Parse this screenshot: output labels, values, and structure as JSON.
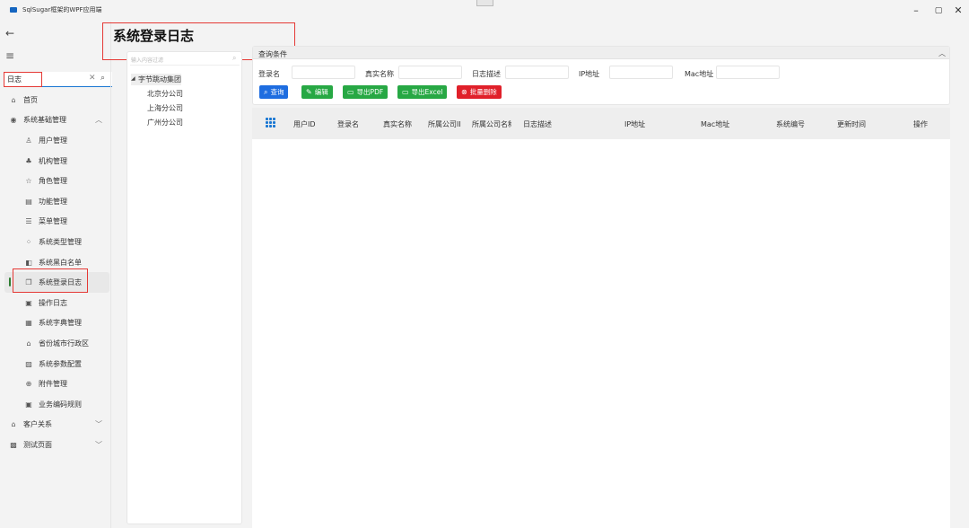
{
  "window": {
    "title": "SqlSugar框架的WPF应用端",
    "minimize": "–",
    "maximize": "▢",
    "close": "✕"
  },
  "nav": {
    "back": "←",
    "menu": "≡",
    "search_value": "日志",
    "search_clear": "✕",
    "search_icon": "⌕",
    "items": [
      {
        "label": "首页",
        "icon": "⌂"
      },
      {
        "label": "系统基础管理",
        "icon": "◉",
        "chevron": "︿"
      },
      {
        "label": "用户管理",
        "icon": "♙"
      },
      {
        "label": "机构管理",
        "icon": "♣"
      },
      {
        "label": "角色管理",
        "icon": "☆"
      },
      {
        "label": "功能管理",
        "icon": "▤"
      },
      {
        "label": "菜单管理",
        "icon": "☰"
      },
      {
        "label": "系统类型管理",
        "icon": "⁘"
      },
      {
        "label": "系统黑白名单",
        "icon": "◧"
      },
      {
        "label": "系统登录日志",
        "icon": "❐"
      },
      {
        "label": "操作日志",
        "icon": "▣"
      },
      {
        "label": "系统字典管理",
        "icon": "▦"
      },
      {
        "label": "省份城市行政区",
        "icon": "⌂"
      },
      {
        "label": "系统参数配置",
        "icon": "▨"
      },
      {
        "label": "附件管理",
        "icon": "⊕"
      },
      {
        "label": "业务编码规则",
        "icon": "▣"
      },
      {
        "label": "客户关系",
        "icon": "⌂",
        "chevron": "﹀"
      },
      {
        "label": "测试页面",
        "icon": "▩",
        "chevron": "﹀"
      }
    ]
  },
  "page": {
    "title": "系统登录日志"
  },
  "tree": {
    "filter_placeholder": "输入内容过滤",
    "filter_icon": "⌕",
    "root": "字节跳动集团",
    "expander": "◢",
    "children": [
      "北京分公司",
      "上海分公司",
      "广州分公司"
    ]
  },
  "query": {
    "title": "查询条件",
    "collapse": "︿",
    "fields": [
      {
        "label": "登录名",
        "value": ""
      },
      {
        "label": "真实名称",
        "value": ""
      },
      {
        "label": "日志描述",
        "value": ""
      },
      {
        "label": "IP地址",
        "value": ""
      },
      {
        "label": "Mac地址",
        "value": ""
      }
    ],
    "buttons": [
      {
        "label": "查询",
        "icon": "⌕",
        "color": "#1e6de0"
      },
      {
        "label": "编辑",
        "icon": "✎",
        "color": "#27a844"
      },
      {
        "label": "导出PDF",
        "icon": "▭",
        "color": "#27a844"
      },
      {
        "label": "导出Excel",
        "icon": "▭",
        "color": "#27a844"
      },
      {
        "label": "批量删除",
        "icon": "⊗",
        "color": "#e0202a"
      }
    ]
  },
  "grid": {
    "columns": [
      "用户ID",
      "登录名",
      "真实名称",
      "所属公司ID",
      "所属公司名称",
      "日志描述",
      "IP地址",
      "Mac地址",
      "系统编号",
      "更新时间",
      "操作"
    ],
    "rows": []
  }
}
